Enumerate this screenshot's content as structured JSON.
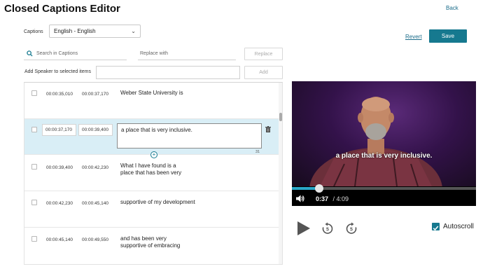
{
  "header": {
    "title": "Closed Captions Editor",
    "back_label": "Back"
  },
  "captions_select": {
    "label": "Captions",
    "value": "English - English"
  },
  "actions": {
    "revert_label": "Revert",
    "save_label": "Save"
  },
  "search": {
    "placeholder": "Search in Captions",
    "replace_placeholder": "Replace with",
    "replace_button": "Replace"
  },
  "speaker": {
    "label": "Add Speaker to selected items",
    "add_button": "Add"
  },
  "captions": [
    {
      "start": "00:00:35,010",
      "end": "00:00:37,170",
      "text": [
        "Weber State University is"
      ]
    },
    {
      "start": "00:00:37,170",
      "end": "00:00:39,400",
      "text": [
        "a place that is very inclusive."
      ],
      "char_count": "31",
      "active": true
    },
    {
      "start": "00:00:39,400",
      "end": "00:00:42,230",
      "text": [
        "What I have found is a",
        "place that has been very"
      ]
    },
    {
      "start": "00:00:42,230",
      "end": "00:00:45,140",
      "text": [
        "supportive of my development"
      ]
    },
    {
      "start": "00:00:45,140",
      "end": "00:00:49,550",
      "text": [
        "and has been very",
        "supportive of embracing"
      ]
    }
  ],
  "player": {
    "caption": "a place that is very inclusive.",
    "current_time": "0:37",
    "duration": "/ 4:09",
    "progress": 0.15
  },
  "autoscroll": {
    "label": "Autoscroll",
    "checked": true
  },
  "colors": {
    "accent": "#16798f",
    "active_row": "#d9eef6",
    "progress": "#2aa7c8"
  }
}
